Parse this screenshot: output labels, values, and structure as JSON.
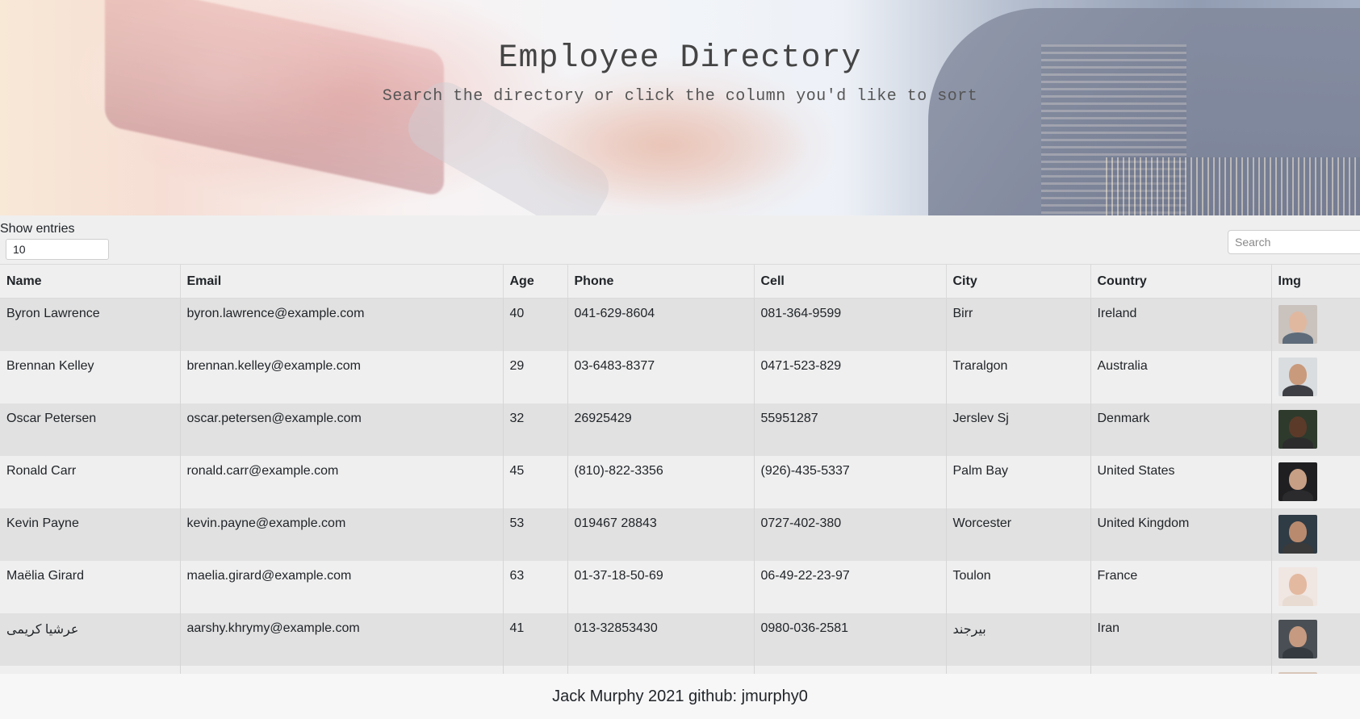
{
  "header": {
    "title": "Employee Directory",
    "subtitle": "Search the directory or click the column you'd like to sort"
  },
  "controls": {
    "show_entries_label": "Show entries",
    "entries_value": "10",
    "search_placeholder": "Search"
  },
  "table": {
    "columns": [
      "Name",
      "Email",
      "Age",
      "Phone",
      "Cell",
      "City",
      "Country",
      "Img"
    ],
    "rows": [
      {
        "name": "Byron Lawrence",
        "email": "byron.lawrence@example.com",
        "age": "40",
        "phone": "041-629-8604",
        "cell": "081-364-9599",
        "city": "Birr",
        "country": "Ireland",
        "avatar_bg": "#c9c2bd",
        "avatar_skin": "#e0b8a0",
        "avatar_shirt": "#5d6b7a"
      },
      {
        "name": "Brennan Kelley",
        "email": "brennan.kelley@example.com",
        "age": "29",
        "phone": "03-6483-8377",
        "cell": "0471-523-829",
        "city": "Traralgon",
        "country": "Australia",
        "avatar_bg": "#d9dde0",
        "avatar_skin": "#c99a7c",
        "avatar_shirt": "#3d3f45"
      },
      {
        "name": "Oscar Petersen",
        "email": "oscar.petersen@example.com",
        "age": "32",
        "phone": "26925429",
        "cell": "55951287",
        "city": "Jerslev Sj",
        "country": "Denmark",
        "avatar_bg": "#2e3a2c",
        "avatar_skin": "#5b3a2a",
        "avatar_shirt": "#2c2c2c"
      },
      {
        "name": "Ronald Carr",
        "email": "ronald.carr@example.com",
        "age": "45",
        "phone": "(810)-822-3356",
        "cell": "(926)-435-5337",
        "city": "Palm Bay",
        "country": "United States",
        "avatar_bg": "#1f1f22",
        "avatar_skin": "#c79f85",
        "avatar_shirt": "#2b2b2e"
      },
      {
        "name": "Kevin Payne",
        "email": "kevin.payne@example.com",
        "age": "53",
        "phone": "019467 28843",
        "cell": "0727-402-380",
        "city": "Worcester",
        "country": "United Kingdom",
        "avatar_bg": "#2f3b45",
        "avatar_skin": "#b98a6e",
        "avatar_shirt": "#3a3a3a"
      },
      {
        "name": "Maëlia Girard",
        "email": "maelia.girard@example.com",
        "age": "63",
        "phone": "01-37-18-50-69",
        "cell": "06-49-22-23-97",
        "city": "Toulon",
        "country": "France",
        "avatar_bg": "#f0e6e2",
        "avatar_skin": "#e3b9a0",
        "avatar_shirt": "#e8dcd2"
      },
      {
        "name": "عرشيا كريمی",
        "email": "aarshy.khrymy@example.com",
        "age": "41",
        "phone": "013-32853430",
        "cell": "0980-036-2581",
        "city": "بیرجند",
        "country": "Iran",
        "avatar_bg": "#4a4f55",
        "avatar_skin": "#c69a80",
        "avatar_shirt": "#353a40"
      },
      {
        "name": "",
        "email": "",
        "age": "",
        "phone": "",
        "cell": "",
        "city": "",
        "country": "",
        "avatar_bg": "#d8c6b8",
        "avatar_skin": "#3a2a22",
        "avatar_shirt": "#555"
      }
    ]
  },
  "footer": {
    "text": "Jack Murphy 2021 github: jmurphy0"
  }
}
